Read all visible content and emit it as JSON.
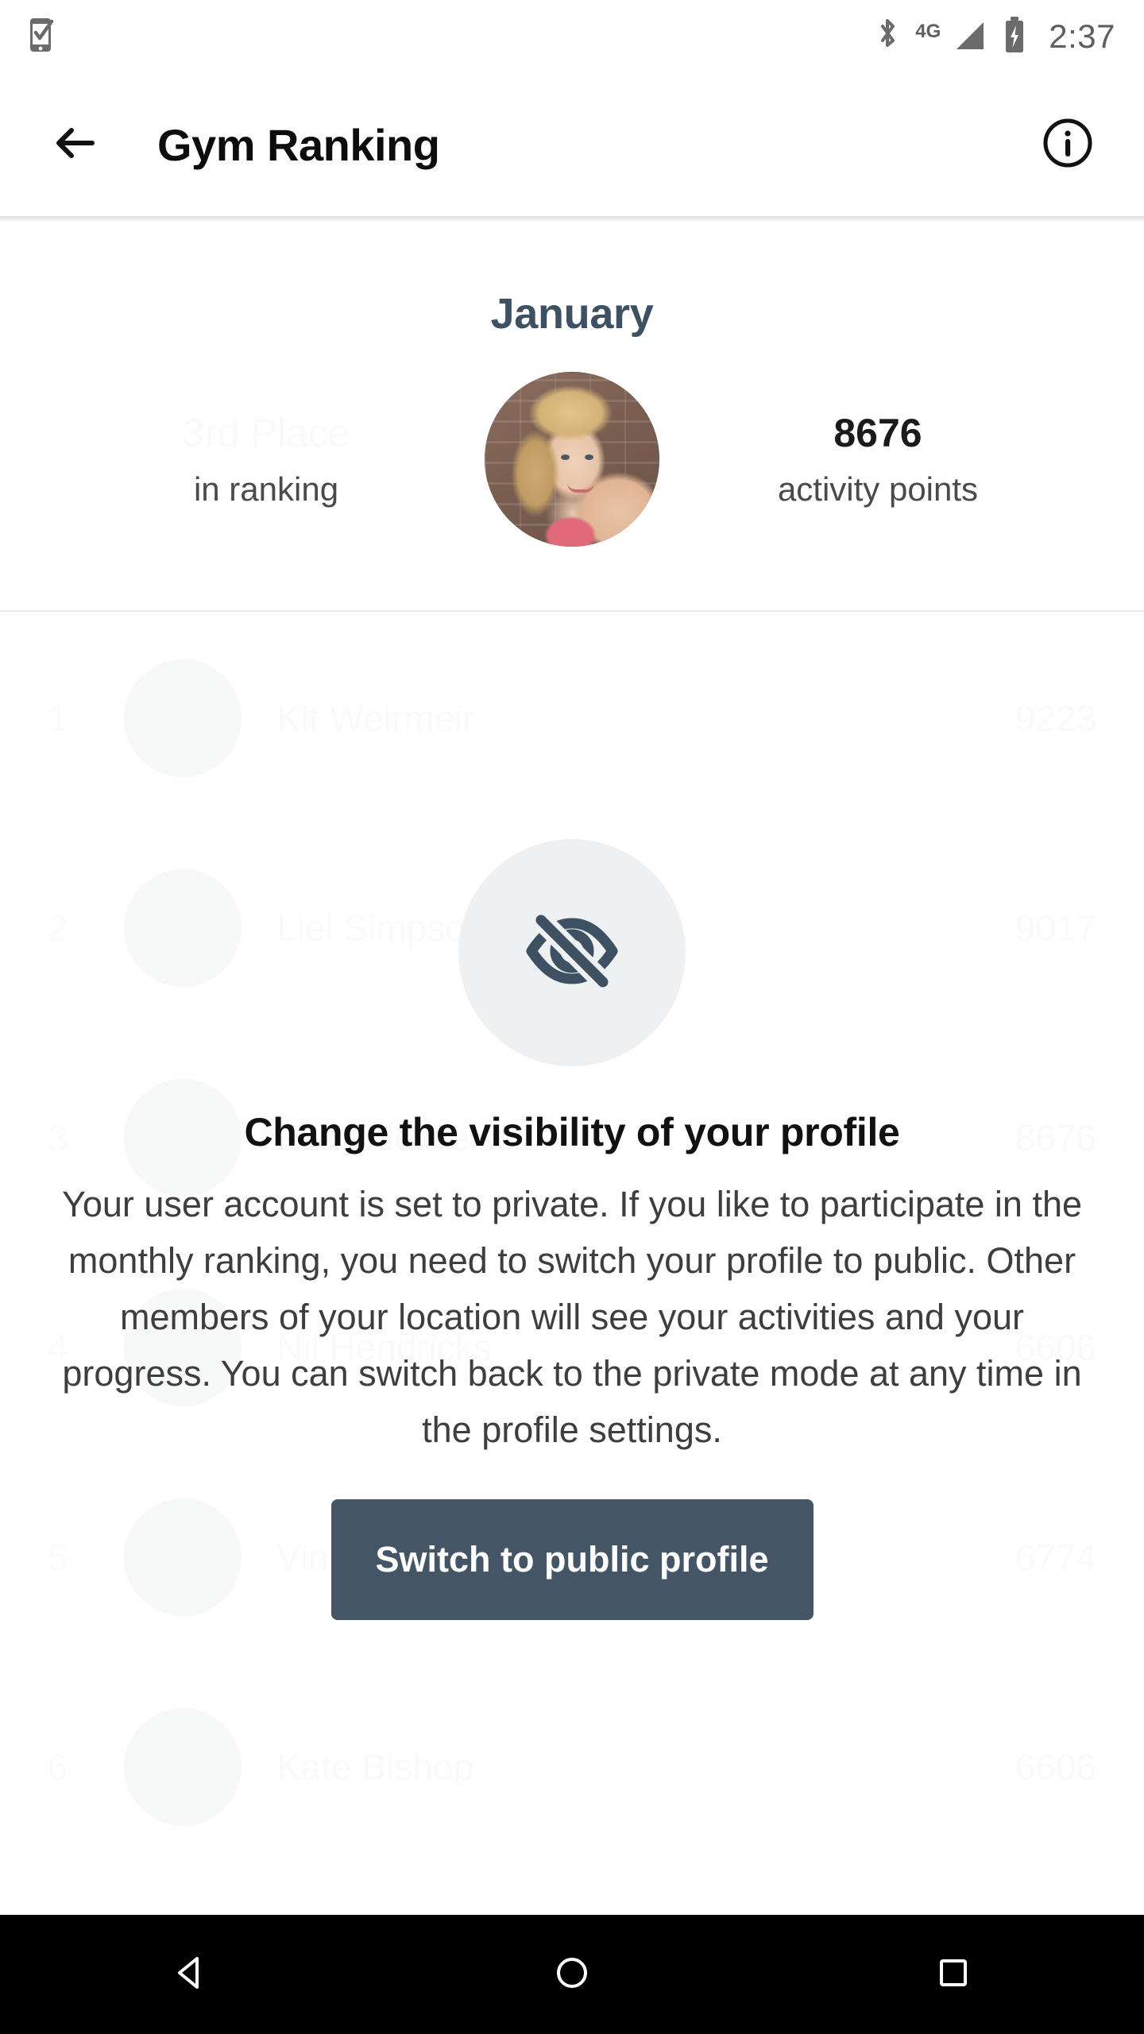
{
  "status_bar": {
    "left_icons": [
      {
        "name": "phone-check-icon",
        "glyph": "phone-check"
      }
    ],
    "right_icons": [
      {
        "name": "bluetooth-icon",
        "glyph": "bluetooth"
      },
      {
        "name": "network-4g-icon",
        "glyph": "4G"
      },
      {
        "name": "signal-bars-icon",
        "glyph": "signal"
      },
      {
        "name": "battery-charging-icon",
        "glyph": "battery-charging"
      }
    ],
    "network_label": "4G",
    "time": "2:37"
  },
  "app_bar": {
    "back_icon": "arrow-left-icon",
    "title": "Gym Ranking",
    "info_icon": "info-circle-icon"
  },
  "summary": {
    "month": "January",
    "place_value": "3rd Place",
    "place_label": "in ranking",
    "points_value": "8676",
    "points_label": "activity points",
    "avatar_alt": "user-avatar"
  },
  "ranking": {
    "rows": [
      {
        "rank": "1",
        "name": "Kit Weirmeir",
        "points": "9223"
      },
      {
        "rank": "2",
        "name": "Liel Simpson",
        "points": "9017"
      },
      {
        "rank": "3",
        "name": "Eva Edelweiss",
        "points": "8676"
      },
      {
        "rank": "4",
        "name": "Nil Hendricks",
        "points": "6606"
      },
      {
        "rank": "5",
        "name": "Vincent Aegerbaum",
        "points": "6774"
      },
      {
        "rank": "6",
        "name": "Kate Bishop",
        "points": "6606"
      }
    ]
  },
  "overlay": {
    "icon": "eye-off-icon",
    "title": "Change the visibility of your profile",
    "body": "Your user account is set to private. If you like to participate in the monthly ranking, you need to switch your profile to public. Other members of your location will see your activities and your progress. You can switch back to the private mode at any time in the profile settings.",
    "button_label": "Switch to public profile"
  },
  "nav_bar": {
    "back": "nav-back-icon",
    "home": "nav-home-icon",
    "recents": "nav-recents-icon"
  },
  "colors": {
    "accent": "#3d5163",
    "button": "#445566",
    "nav_bar": "#000000",
    "faded_text": "#fafafa",
    "body_text": "#3e3e3e"
  }
}
